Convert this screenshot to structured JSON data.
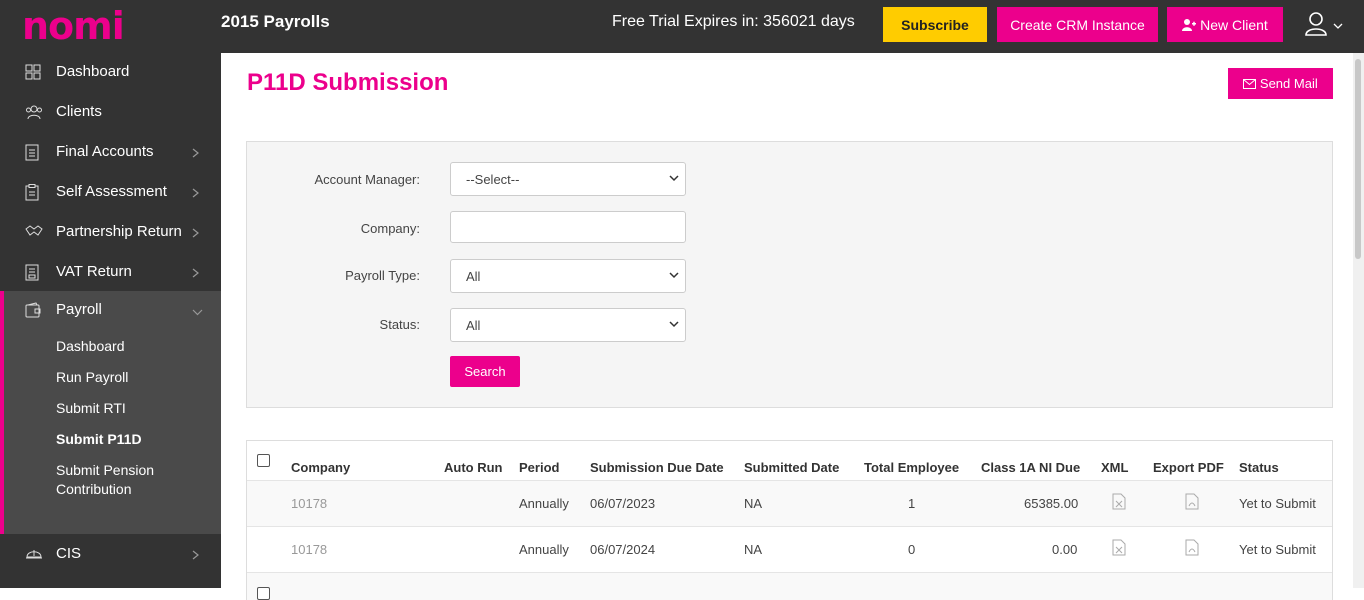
{
  "header": {
    "logo": "nomi",
    "app_title": "2015 Payrolls",
    "trial_text": "Free Trial Expires in: 356021 days",
    "subscribe_label": "Subscribe",
    "crm_label": "Create CRM Instance",
    "new_client_label": "New Client",
    "accent": "#ec008c",
    "subscribe_color": "#ffcc00"
  },
  "sidebar": {
    "items": [
      {
        "label": "Dashboard",
        "icon": "grid-icon"
      },
      {
        "label": "Clients",
        "icon": "users-icon"
      },
      {
        "label": "Final Accounts",
        "icon": "document-icon"
      },
      {
        "label": "Self Assessment",
        "icon": "clipboard-icon"
      },
      {
        "label": "Partnership Return",
        "icon": "handshake-icon"
      },
      {
        "label": "VAT Return",
        "icon": "receipt-icon"
      },
      {
        "label": "Payroll",
        "icon": "wallet-icon"
      },
      {
        "label": "CIS",
        "icon": "helmet-icon"
      }
    ],
    "payroll_sub": [
      "Dashboard",
      "Run Payroll",
      "Submit RTI",
      "Submit P11D",
      "Submit Pension",
      "Contribution"
    ],
    "active_sub": "Submit P11D"
  },
  "main": {
    "title": "P11D Submission",
    "send_mail_label": "Send Mail",
    "filters": {
      "account_manager_label": "Account Manager:",
      "account_manager_value": "--Select--",
      "company_label": "Company:",
      "company_value": "",
      "payroll_type_label": "Payroll Type:",
      "payroll_type_value": "All",
      "status_label": "Status:",
      "status_value": "All",
      "search_label": "Search"
    },
    "table": {
      "headers": [
        "Company",
        "Auto Run",
        "Period",
        "Submission Due Date",
        "Submitted Date",
        "Total Employee",
        "Class 1A NI Due",
        "XML",
        "Export PDF",
        "Status"
      ],
      "rows": [
        {
          "company": "10178",
          "auto_run": "",
          "period": "Annually",
          "due": "06/07/2023",
          "submitted": "NA",
          "employees": "1",
          "ni_due": "65385.00",
          "status": "Yet to Submit"
        },
        {
          "company": "10178",
          "auto_run": "",
          "period": "Annually",
          "due": "06/07/2024",
          "submitted": "NA",
          "employees": "0",
          "ni_due": "0.00",
          "status": "Yet to Submit"
        }
      ]
    }
  }
}
